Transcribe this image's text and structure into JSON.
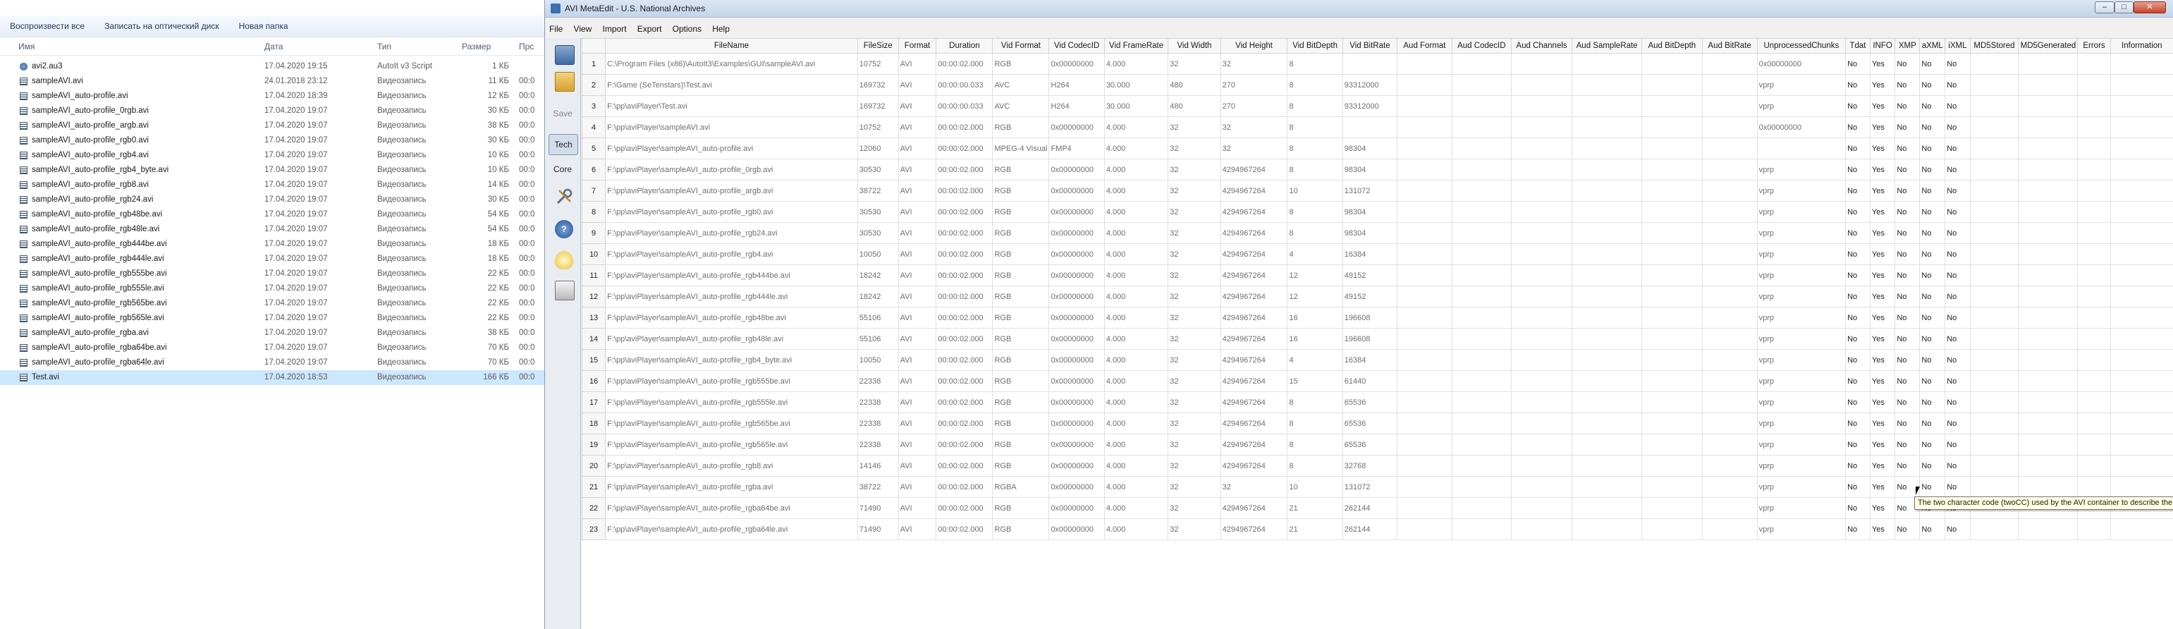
{
  "explorer": {
    "toolbar": [
      "Воспроизвести все",
      "Записать на оптический диск",
      "Новая папка"
    ],
    "columns": {
      "name": "Имя",
      "date": "Дата",
      "type": "Тип",
      "size": "Размер",
      "extra": "Прс"
    },
    "files": [
      {
        "icon": "script-file-icon",
        "name": "avi2.au3",
        "date": "17.04.2020 19:15",
        "type": "AutoIt v3 Script",
        "size": "1 КБ",
        "extra": ""
      },
      {
        "icon": "video-file-icon",
        "name": "sampleAVI.avi",
        "date": "24.01.2018 23:12",
        "type": "Видеозапись",
        "size": "11 КБ",
        "extra": "00:0"
      },
      {
        "icon": "video-file-icon",
        "name": "sampleAVI_auto-profile.avi",
        "date": "17.04.2020 18:39",
        "type": "Видеозапись",
        "size": "12 КБ",
        "extra": "00:0"
      },
      {
        "icon": "video-file-icon",
        "name": "sampleAVI_auto-profile_0rgb.avi",
        "date": "17.04.2020 19:07",
        "type": "Видеозапись",
        "size": "30 КБ",
        "extra": "00:0"
      },
      {
        "icon": "video-file-icon",
        "name": "sampleAVI_auto-profile_argb.avi",
        "date": "17.04.2020 19:07",
        "type": "Видеозапись",
        "size": "38 КБ",
        "extra": "00:0"
      },
      {
        "icon": "video-file-icon",
        "name": "sampleAVI_auto-profile_rgb0.avi",
        "date": "17.04.2020 19:07",
        "type": "Видеозапись",
        "size": "30 КБ",
        "extra": "00:0"
      },
      {
        "icon": "video-file-icon",
        "name": "sampleAVI_auto-profile_rgb4.avi",
        "date": "17.04.2020 19:07",
        "type": "Видеозапись",
        "size": "10 КБ",
        "extra": "00:0"
      },
      {
        "icon": "video-file-icon",
        "name": "sampleAVI_auto-profile_rgb4_byte.avi",
        "date": "17.04.2020 19:07",
        "type": "Видеозапись",
        "size": "10 КБ",
        "extra": "00:0"
      },
      {
        "icon": "video-file-icon",
        "name": "sampleAVI_auto-profile_rgb8.avi",
        "date": "17.04.2020 19:07",
        "type": "Видеозапись",
        "size": "14 КБ",
        "extra": "00:0"
      },
      {
        "icon": "video-file-icon",
        "name": "sampleAVI_auto-profile_rgb24.avi",
        "date": "17.04.2020 19:07",
        "type": "Видеозапись",
        "size": "30 КБ",
        "extra": "00:0"
      },
      {
        "icon": "video-file-icon",
        "name": "sampleAVI_auto-profile_rgb48be.avi",
        "date": "17.04.2020 19:07",
        "type": "Видеозапись",
        "size": "54 КБ",
        "extra": "00:0"
      },
      {
        "icon": "video-file-icon",
        "name": "sampleAVI_auto-profile_rgb48le.avi",
        "date": "17.04.2020 19:07",
        "type": "Видеозапись",
        "size": "54 КБ",
        "extra": "00:0"
      },
      {
        "icon": "video-file-icon",
        "name": "sampleAVI_auto-profile_rgb444be.avi",
        "date": "17.04.2020 19:07",
        "type": "Видеозапись",
        "size": "18 КБ",
        "extra": "00:0"
      },
      {
        "icon": "video-file-icon",
        "name": "sampleAVI_auto-profile_rgb444le.avi",
        "date": "17.04.2020 19:07",
        "type": "Видеозапись",
        "size": "18 КБ",
        "extra": "00:0"
      },
      {
        "icon": "video-file-icon",
        "name": "sampleAVI_auto-profile_rgb555be.avi",
        "date": "17.04.2020 19:07",
        "type": "Видеозапись",
        "size": "22 КБ",
        "extra": "00:0"
      },
      {
        "icon": "video-file-icon",
        "name": "sampleAVI_auto-profile_rgb555le.avi",
        "date": "17.04.2020 19:07",
        "type": "Видеозапись",
        "size": "22 КБ",
        "extra": "00:0"
      },
      {
        "icon": "video-file-icon",
        "name": "sampleAVI_auto-profile_rgb565be.avi",
        "date": "17.04.2020 19:07",
        "type": "Видеозапись",
        "size": "22 КБ",
        "extra": "00:0"
      },
      {
        "icon": "video-file-icon",
        "name": "sampleAVI_auto-profile_rgb565le.avi",
        "date": "17.04.2020 19:07",
        "type": "Видеозапись",
        "size": "22 КБ",
        "extra": "00:0"
      },
      {
        "icon": "video-file-icon",
        "name": "sampleAVI_auto-profile_rgba.avi",
        "date": "17.04.2020 19:07",
        "type": "Видеозапись",
        "size": "38 КБ",
        "extra": "00:0"
      },
      {
        "icon": "video-file-icon",
        "name": "sampleAVI_auto-profile_rgba64be.avi",
        "date": "17.04.2020 19:07",
        "type": "Видеозапись",
        "size": "70 КБ",
        "extra": "00:0"
      },
      {
        "icon": "video-file-icon",
        "name": "sampleAVI_auto-profile_rgba64le.avi",
        "date": "17.04.2020 19:07",
        "type": "Видеозапись",
        "size": "70 КБ",
        "extra": "00:0"
      },
      {
        "icon": "video-file-icon",
        "name": "Test.avi",
        "date": "17.04.2020 18:53",
        "type": "Видеозапись",
        "size": "166 КБ",
        "extra": "00:0",
        "selected": true
      }
    ]
  },
  "app": {
    "title": "AVI MetaEdit - U.S. National Archives",
    "window_buttons": {
      "minimize": "–",
      "maximize": "□",
      "close": "✕"
    },
    "menu": [
      "File",
      "View",
      "Import",
      "Export",
      "Options",
      "Help"
    ],
    "sidebar": {
      "save": "Save",
      "tech": "Tech",
      "core": "Core",
      "help": "?"
    },
    "columns": [
      "",
      "FileName",
      "FileSize",
      "Format",
      "Duration",
      "Vid Format",
      "Vid CodecID",
      "Vid FrameRate",
      "Vid Width",
      "Vid Height",
      "Vid BitDepth",
      "Vid BitRate",
      "Aud Format",
      "Aud CodecID",
      "Aud Channels",
      "Aud SampleRate",
      "Aud BitDepth",
      "Aud BitRate",
      "UnprocessedChunks",
      "Tdat",
      "INFO",
      "XMP",
      "aXML",
      "iXML",
      "MD5Stored",
      "MD5Generated",
      "Errors",
      "Information"
    ],
    "rows": [
      [
        "1",
        "C:\\Program Files (x86)\\AutoIt3\\Examples\\GUI\\sampleAVI.avi",
        "10752",
        "AVI",
        "00:00:02.000",
        "RGB",
        "0x00000000",
        "4.000",
        "32",
        "32",
        "8",
        "",
        "",
        "",
        "",
        "",
        "",
        "",
        "0x00000000",
        "No",
        "Yes",
        "No",
        "No",
        "No",
        "",
        "",
        "",
        ""
      ],
      [
        "2",
        "F:\\Game (SeTenstars)\\Test.avi",
        "169732",
        "AVI",
        "00:00:00.033",
        "AVC",
        "H264",
        "30.000",
        "480",
        "270",
        "8",
        "93312000",
        "",
        "",
        "",
        "",
        "",
        "",
        "vprp",
        "No",
        "Yes",
        "No",
        "No",
        "No",
        "",
        "",
        "",
        ""
      ],
      [
        "3",
        "F:\\pp\\aviPlayer\\Test.avi",
        "169732",
        "AVI",
        "00:00:00.033",
        "AVC",
        "H264",
        "30.000",
        "480",
        "270",
        "8",
        "93312000",
        "",
        "",
        "",
        "",
        "",
        "",
        "vprp",
        "No",
        "Yes",
        "No",
        "No",
        "No",
        "",
        "",
        "",
        ""
      ],
      [
        "4",
        "F:\\pp\\aviPlayer\\sampleAVI.avi",
        "10752",
        "AVI",
        "00:00:02.000",
        "RGB",
        "0x00000000",
        "4.000",
        "32",
        "32",
        "8",
        "",
        "",
        "",
        "",
        "",
        "",
        "",
        "0x00000000",
        "No",
        "Yes",
        "No",
        "No",
        "No",
        "",
        "",
        "",
        ""
      ],
      [
        "5",
        "F:\\pp\\aviPlayer\\sampleAVI_auto-profile.avi",
        "12060",
        "AVI",
        "00:00:02.000",
        "MPEG-4 Visual",
        "FMP4",
        "4.000",
        "32",
        "32",
        "8",
        "98304",
        "",
        "",
        "",
        "",
        "",
        "",
        "",
        "No",
        "Yes",
        "No",
        "No",
        "No",
        "",
        "",
        "",
        ""
      ],
      [
        "6",
        "F:\\pp\\aviPlayer\\sampleAVI_auto-profile_0rgb.avi",
        "30530",
        "AVI",
        "00:00:02.000",
        "RGB",
        "0x00000000",
        "4.000",
        "32",
        "4294967264",
        "8",
        "98304",
        "",
        "",
        "",
        "",
        "",
        "",
        "vprp",
        "No",
        "Yes",
        "No",
        "No",
        "No",
        "",
        "",
        "",
        ""
      ],
      [
        "7",
        "F:\\pp\\aviPlayer\\sampleAVI_auto-profile_argb.avi",
        "38722",
        "AVI",
        "00:00:02.000",
        "RGB",
        "0x00000000",
        "4.000",
        "32",
        "4294967264",
        "10",
        "131072",
        "",
        "",
        "",
        "",
        "",
        "",
        "vprp",
        "No",
        "Yes",
        "No",
        "No",
        "No",
        "",
        "",
        "",
        ""
      ],
      [
        "8",
        "F:\\pp\\aviPlayer\\sampleAVI_auto-profile_rgb0.avi",
        "30530",
        "AVI",
        "00:00:02.000",
        "RGB",
        "0x00000000",
        "4.000",
        "32",
        "4294967264",
        "8",
        "98304",
        "",
        "",
        "",
        "",
        "",
        "",
        "vprp",
        "No",
        "Yes",
        "No",
        "No",
        "No",
        "",
        "",
        "",
        ""
      ],
      [
        "9",
        "F:\\pp\\aviPlayer\\sampleAVI_auto-profile_rgb24.avi",
        "30530",
        "AVI",
        "00:00:02.000",
        "RGB",
        "0x00000000",
        "4.000",
        "32",
        "4294967264",
        "8",
        "98304",
        "",
        "",
        "",
        "",
        "",
        "",
        "vprp",
        "No",
        "Yes",
        "No",
        "No",
        "No",
        "",
        "",
        "",
        ""
      ],
      [
        "10",
        "F:\\pp\\aviPlayer\\sampleAVI_auto-profile_rgb4.avi",
        "10050",
        "AVI",
        "00:00:02.000",
        "RGB",
        "0x00000000",
        "4.000",
        "32",
        "4294967264",
        "4",
        "16384",
        "",
        "",
        "",
        "",
        "",
        "",
        "vprp",
        "No",
        "Yes",
        "No",
        "No",
        "No",
        "",
        "",
        "",
        ""
      ],
      [
        "11",
        "F:\\pp\\aviPlayer\\sampleAVI_auto-profile_rgb444be.avi",
        "18242",
        "AVI",
        "00:00:02.000",
        "RGB",
        "0x00000000",
        "4.000",
        "32",
        "4294967264",
        "12",
        "49152",
        "",
        "",
        "",
        "",
        "",
        "",
        "vprp",
        "No",
        "Yes",
        "No",
        "No",
        "No",
        "",
        "",
        "",
        ""
      ],
      [
        "12",
        "F:\\pp\\aviPlayer\\sampleAVI_auto-profile_rgb444le.avi",
        "18242",
        "AVI",
        "00:00:02.000",
        "RGB",
        "0x00000000",
        "4.000",
        "32",
        "4294967264",
        "12",
        "49152",
        "",
        "",
        "",
        "",
        "",
        "",
        "vprp",
        "No",
        "Yes",
        "No",
        "No",
        "No",
        "",
        "",
        "",
        ""
      ],
      [
        "13",
        "F:\\pp\\aviPlayer\\sampleAVI_auto-profile_rgb48be.avi",
        "55106",
        "AVI",
        "00:00:02.000",
        "RGB",
        "0x00000000",
        "4.000",
        "32",
        "4294967264",
        "16",
        "196608",
        "",
        "",
        "",
        "",
        "",
        "",
        "vprp",
        "No",
        "Yes",
        "No",
        "No",
        "No",
        "",
        "",
        "",
        ""
      ],
      [
        "14",
        "F:\\pp\\aviPlayer\\sampleAVI_auto-profile_rgb48le.avi",
        "55106",
        "AVI",
        "00:00:02.000",
        "RGB",
        "0x00000000",
        "4.000",
        "32",
        "4294967264",
        "16",
        "196608",
        "",
        "",
        "",
        "",
        "",
        "",
        "vprp",
        "No",
        "Yes",
        "No",
        "No",
        "No",
        "",
        "",
        "",
        ""
      ],
      [
        "15",
        "F:\\pp\\aviPlayer\\sampleAVI_auto-profile_rgb4_byte.avi",
        "10050",
        "AVI",
        "00:00:02.000",
        "RGB",
        "0x00000000",
        "4.000",
        "32",
        "4294967264",
        "4",
        "16384",
        "",
        "",
        "",
        "",
        "",
        "",
        "vprp",
        "No",
        "Yes",
        "No",
        "No",
        "No",
        "",
        "",
        "",
        ""
      ],
      [
        "16",
        "F:\\pp\\aviPlayer\\sampleAVI_auto-profile_rgb555be.avi",
        "22338",
        "AVI",
        "00:00:02.000",
        "RGB",
        "0x00000000",
        "4.000",
        "32",
        "4294967264",
        "15",
        "61440",
        "",
        "",
        "",
        "",
        "",
        "",
        "vprp",
        "No",
        "Yes",
        "No",
        "No",
        "No",
        "",
        "",
        "",
        ""
      ],
      [
        "17",
        "F:\\pp\\aviPlayer\\sampleAVI_auto-profile_rgb555le.avi",
        "22338",
        "AVI",
        "00:00:02.000",
        "RGB",
        "0x00000000",
        "4.000",
        "32",
        "4294967264",
        "8",
        "65536",
        "",
        "",
        "",
        "",
        "",
        "",
        "vprp",
        "No",
        "Yes",
        "No",
        "No",
        "No",
        "",
        "",
        "",
        ""
      ],
      [
        "18",
        "F:\\pp\\aviPlayer\\sampleAVI_auto-profile_rgb565be.avi",
        "22338",
        "AVI",
        "00:00:02.000",
        "RGB",
        "0x00000000",
        "4.000",
        "32",
        "4294967264",
        "8",
        "65536",
        "",
        "",
        "",
        "",
        "",
        "",
        "vprp",
        "No",
        "Yes",
        "No",
        "No",
        "No",
        "",
        "",
        "",
        ""
      ],
      [
        "19",
        "F:\\pp\\aviPlayer\\sampleAVI_auto-profile_rgb565le.avi",
        "22338",
        "AVI",
        "00:00:02.000",
        "RGB",
        "0x00000000",
        "4.000",
        "32",
        "4294967264",
        "8",
        "65536",
        "",
        "",
        "",
        "",
        "",
        "",
        "vprp",
        "No",
        "Yes",
        "No",
        "No",
        "No",
        "",
        "",
        "",
        ""
      ],
      [
        "20",
        "F:\\pp\\aviPlayer\\sampleAVI_auto-profile_rgb8.avi",
        "14146",
        "AVI",
        "00:00:02.000",
        "RGB",
        "0x00000000",
        "4.000",
        "32",
        "4294967264",
        "8",
        "32768",
        "",
        "",
        "",
        "",
        "",
        "",
        "vprp",
        "No",
        "Yes",
        "No",
        "No",
        "No",
        "",
        "",
        "",
        ""
      ],
      [
        "21",
        "F:\\pp\\aviPlayer\\sampleAVI_auto-profile_rgba.avi",
        "38722",
        "AVI",
        "00:00:02.000",
        "RGBA",
        "0x00000000",
        "4.000",
        "32",
        "32",
        "10",
        "131072",
        "",
        "",
        "",
        "",
        "",
        "",
        "vprp",
        "No",
        "Yes",
        "No",
        "No",
        "No",
        "",
        "",
        "",
        ""
      ],
      [
        "22",
        "F:\\pp\\aviPlayer\\sampleAVI_auto-profile_rgba64be.avi",
        "71490",
        "AVI",
        "00:00:02.000",
        "RGB",
        "0x00000000",
        "4.000",
        "32",
        "4294967264",
        "21",
        "262144",
        "",
        "",
        "",
        "",
        "",
        "",
        "vprp",
        "No",
        "Yes",
        "No",
        "No",
        "No",
        "",
        "",
        "",
        ""
      ],
      [
        "23",
        "F:\\pp\\aviPlayer\\sampleAVI_auto-profile_rgba64le.avi",
        "71490",
        "AVI",
        "00:00:02.000",
        "RGB",
        "0x00000000",
        "4.000",
        "32",
        "4294967264",
        "21",
        "262144",
        "",
        "",
        "",
        "",
        "",
        "",
        "vprp",
        "No",
        "Yes",
        "No",
        "No",
        "No",
        "",
        "",
        "",
        ""
      ]
    ],
    "tooltip": "The two character code (twoCC) used by the AVI container to describe the audio codec."
  }
}
